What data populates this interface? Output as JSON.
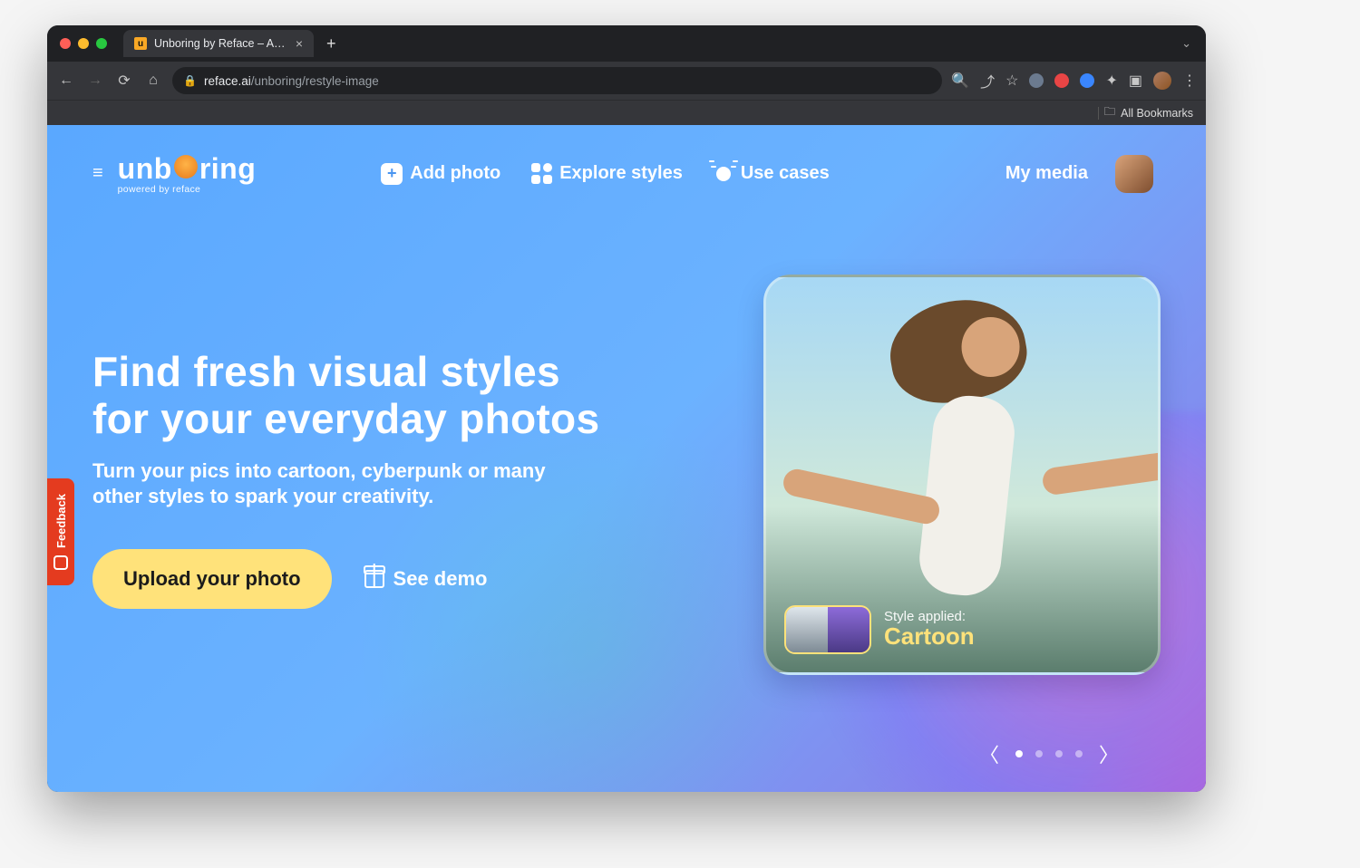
{
  "browser": {
    "tab_title": "Unboring by Reface – AI Photo",
    "url_domain": "reface.ai",
    "url_path": "/unboring/restyle-image",
    "bookmarks_label": "All Bookmarks"
  },
  "header": {
    "logo_text_a": "unb",
    "logo_text_b": "ring",
    "logo_sub": "powered by reface",
    "nav": {
      "add_photo": "Add photo",
      "explore": "Explore styles",
      "use_cases": "Use cases"
    },
    "my_media": "My media"
  },
  "hero": {
    "title": "Find fresh visual styles for your everyday photos",
    "subtitle": "Turn your pics into cartoon, cyberpunk or many other styles to spark your creativity.",
    "cta_primary": "Upload your photo",
    "cta_secondary": "See demo"
  },
  "card": {
    "style_label": "Style applied:",
    "style_name": "Cartoon"
  },
  "carousel": {
    "active_index": 0,
    "count": 4
  },
  "feedback": {
    "label": "Feedback"
  }
}
